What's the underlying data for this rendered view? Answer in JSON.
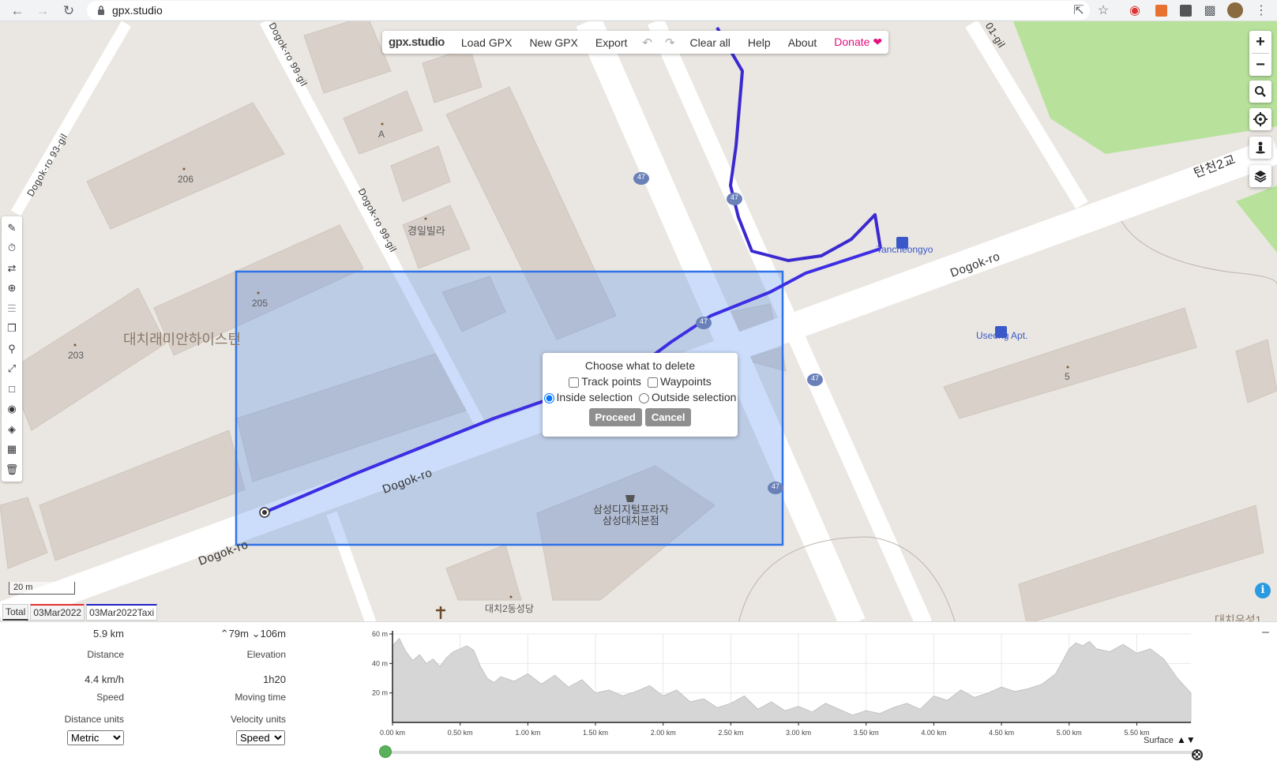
{
  "browser": {
    "url": "gpx.studio"
  },
  "menu": {
    "logo": "gpx.studio",
    "items": [
      "Load GPX",
      "New GPX",
      "Export",
      "Clear all",
      "Help",
      "About"
    ],
    "donate": "Donate"
  },
  "map": {
    "labels": {
      "building_a": "A",
      "building_206": "206",
      "building_205": "205",
      "building_203": "203",
      "building_5": "5",
      "villa": "경일빌라",
      "apartment": "대치래미안하이스턴",
      "store_line1": "삼성디지털프라자",
      "store_line2": "삼성대치본점",
      "church": "대치2동성당",
      "bridge": "탄천2교",
      "bus_stop_1": "Tancheongyo",
      "bus_stop_2": "Useong Apt.",
      "road_dogok_ro_1": "Dogok-ro",
      "road_dogok_ro_2": "Dogok-ro",
      "road_dogok_ro_3": "Dogok-ro",
      "road_93gil": "Dogok-ro 93-gil",
      "road_99gil_1": "Dogok-ro 99-gil",
      "road_99gil_2": "Dogok-ro 99-gil",
      "road_01gil": "01-gil",
      "route_47": "47",
      "partial_bottom_right": "대치우성1"
    },
    "scale": "20 m"
  },
  "dialog": {
    "title": "Choose what to delete",
    "track_points": "Track points",
    "waypoints": "Waypoints",
    "inside": "Inside selection",
    "outside": "Outside selection",
    "proceed": "Proceed",
    "cancel": "Cancel",
    "track_points_checked": false,
    "waypoints_checked": false,
    "selected_option": "inside"
  },
  "tabs": [
    "Total",
    "03Mar2022",
    "03Mar2022Taxi"
  ],
  "stats": {
    "distance_value": "5.9 km",
    "distance_label": "Distance",
    "elevation_up": "79m",
    "elevation_down": "106m",
    "elevation_label": "Elevation",
    "speed_value": "4.4 km/h",
    "speed_label": "Speed",
    "moving_time_value": "1h20",
    "moving_time_label": "Moving time",
    "distance_units_label": "Distance units",
    "distance_units_value": "Metric",
    "velocity_units_label": "Velocity units",
    "velocity_units_value": "Speed"
  },
  "chart_data": {
    "type": "area",
    "y_ticks": [
      "20 m",
      "40 m",
      "60 m"
    ],
    "x_ticks": [
      "0.00 km",
      "0.50 km",
      "1.00 km",
      "1.50 km",
      "2.00 km",
      "2.50 km",
      "3.00 km",
      "3.50 km",
      "4.00 km",
      "4.50 km",
      "5.00 km",
      "5.50 km"
    ],
    "ylim": [
      0,
      60
    ],
    "xlim": [
      0,
      5.9
    ],
    "x": [
      0,
      0.05,
      0.1,
      0.15,
      0.2,
      0.25,
      0.3,
      0.35,
      0.4,
      0.45,
      0.5,
      0.55,
      0.6,
      0.65,
      0.7,
      0.75,
      0.8,
      0.9,
      1.0,
      1.1,
      1.2,
      1.3,
      1.4,
      1.5,
      1.6,
      1.7,
      1.8,
      1.9,
      2.0,
      2.1,
      2.2,
      2.3,
      2.4,
      2.5,
      2.6,
      2.7,
      2.8,
      2.9,
      3.0,
      3.1,
      3.2,
      3.3,
      3.4,
      3.5,
      3.6,
      3.7,
      3.8,
      3.9,
      4.0,
      4.1,
      4.2,
      4.3,
      4.4,
      4.5,
      4.6,
      4.7,
      4.8,
      4.9,
      5.0,
      5.05,
      5.1,
      5.15,
      5.2,
      5.3,
      5.4,
      5.5,
      5.6,
      5.7,
      5.8,
      5.9
    ],
    "y": [
      52,
      57,
      48,
      42,
      46,
      40,
      43,
      38,
      44,
      48,
      50,
      52,
      49,
      38,
      30,
      27,
      31,
      28,
      33,
      26,
      32,
      24,
      29,
      20,
      22,
      18,
      21,
      25,
      18,
      22,
      14,
      16,
      10,
      13,
      18,
      9,
      14,
      8,
      11,
      7,
      13,
      9,
      5,
      8,
      6,
      10,
      13,
      9,
      18,
      15,
      22,
      17,
      20,
      24,
      21,
      23,
      26,
      33,
      50,
      54,
      52,
      55,
      50,
      48,
      53,
      47,
      50,
      43,
      30,
      20
    ],
    "x_label": "Surface"
  },
  "colors": {
    "track_primary": "#3d2ee3",
    "track_secondary": "#3b29d0",
    "selection": "#2f73e8",
    "donate": "#e20f7f",
    "park": "#b8e29c",
    "road": "#ffffff",
    "building": "#d9d0c9",
    "chart_fill": "#d6d6d6",
    "slider_start": "#5bb15b"
  },
  "icons": {
    "back": "arrow-left-icon",
    "forward": "arrow-right-icon",
    "reload": "reload-icon",
    "lock": "lock-icon",
    "share": "share-icon",
    "star": "star-icon",
    "puzzle": "puzzle-icon",
    "more": "more-vert-icon"
  }
}
